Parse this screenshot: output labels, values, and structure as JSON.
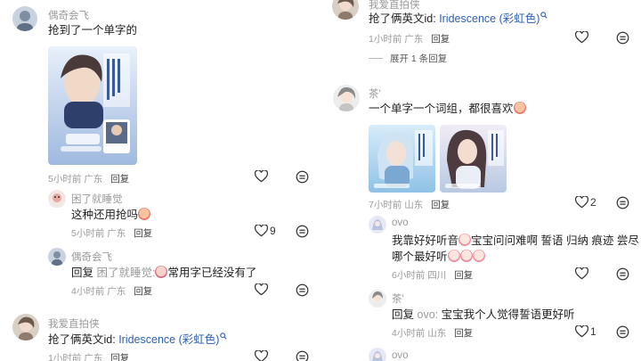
{
  "left": {
    "c1": {
      "user": "偶奇会飞",
      "text": "抢到了一个单字的",
      "time": "5小时前",
      "loc": "广东",
      "reply": "回复"
    },
    "r1": {
      "user": "困了就睡觉",
      "text": "这种还用抢吗",
      "time": "5小时前",
      "loc": "广东",
      "reply": "回复",
      "likes": "9"
    },
    "r2": {
      "user": "偶奇会飞",
      "prefix": "回复",
      "to": "困了就睡觉:",
      "text": "常用字已经没有了",
      "time": "4小时前",
      "loc": "广东",
      "reply": "回复"
    },
    "c2": {
      "user": "我爱直拍侠",
      "text_prefix": "抢了俩英文id: ",
      "brand": "Iridescence",
      "text_suffix": " (彩虹色)",
      "time": "1小时前",
      "loc": "广东",
      "reply": "回复"
    }
  },
  "right": {
    "c1": {
      "user": "我爱直拍侠",
      "text_prefix": "抢了俩英文id: ",
      "brand": "Iridescence",
      "text_suffix": " (彩虹色)",
      "time": "1小时前",
      "loc": "广东",
      "reply": "回复",
      "expand": "展开 1 条回复"
    },
    "c2": {
      "user": "茶'",
      "text": "一个单字一个词组，都很喜欢",
      "time": "7小时前",
      "loc": "山东",
      "reply": "回复",
      "likes": "2"
    },
    "r1": {
      "user": "ovo",
      "line1": "我靠好好听音",
      "line1b": "宝宝问问难啊 誓语 归纳 痕迹 尝尽",
      "line2": "哪个最好听",
      "time": "6小时前",
      "loc": "四川",
      "reply": "回复"
    },
    "r2": {
      "user": "茶'",
      "prefix": "回复",
      "to": "ovo:",
      "text": "宝宝我个人觉得誓语更好听",
      "time": "4小时前",
      "loc": "山东",
      "reply": "回复",
      "likes": "1"
    },
    "r3": {
      "user": "ovo"
    }
  },
  "icons": {
    "like": "heart-icon",
    "more": "comment-menu-icon",
    "emoji": "sticker-emoji-icon"
  }
}
